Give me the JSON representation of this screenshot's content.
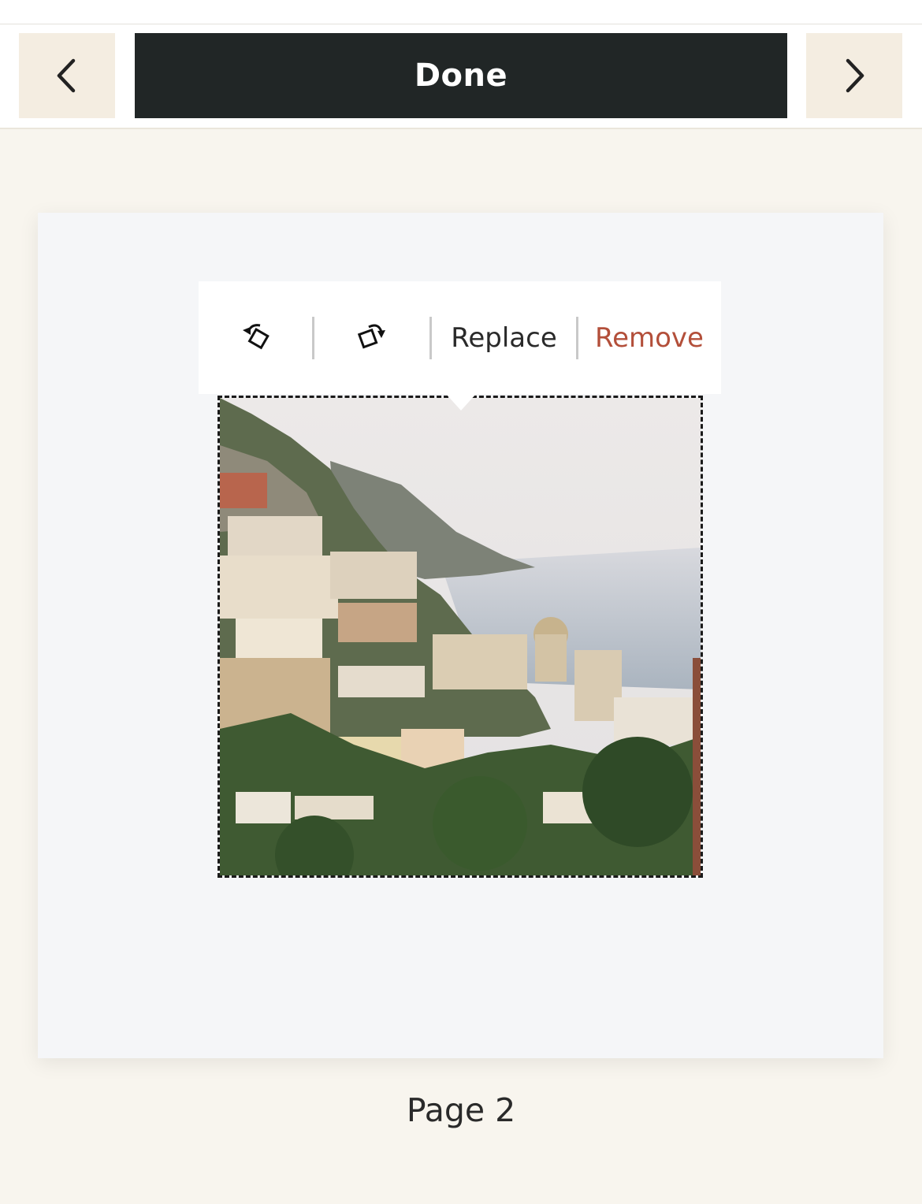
{
  "toolbar": {
    "prev_icon": "chevron-left-icon",
    "done_label": "Done",
    "next_icon": "chevron-right-icon"
  },
  "popover": {
    "rotate_left_icon": "rotate-left-icon",
    "rotate_right_icon": "rotate-right-icon",
    "replace_label": "Replace",
    "remove_label": "Remove"
  },
  "photo": {
    "subject": "coastal-town-photo"
  },
  "page": {
    "label": "Page 2"
  },
  "colors": {
    "background": "#f8f5ee",
    "done_bg": "#212626",
    "nav_bg": "#f4ede1",
    "remove": "#b34f3a",
    "card": "#f5f6f8"
  }
}
